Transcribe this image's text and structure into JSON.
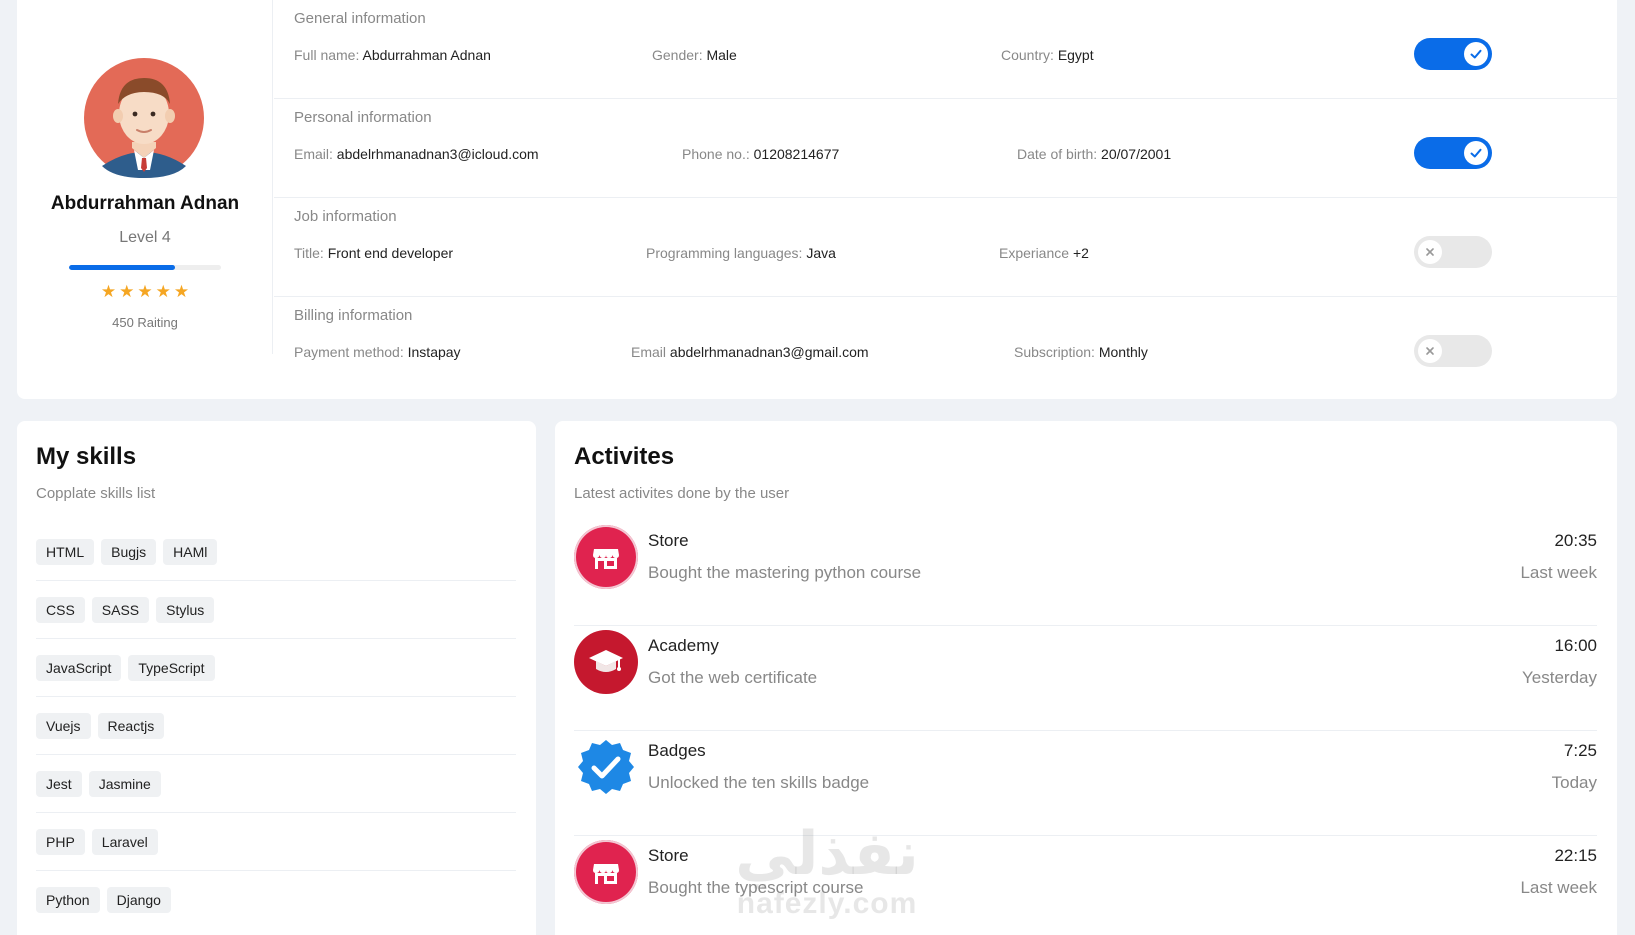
{
  "profile": {
    "name": "Abdurrahman Adnan",
    "level": "Level 4",
    "level_progress": 0.7,
    "stars": 5,
    "rating": "450 Raiting"
  },
  "sections": [
    {
      "title": "General information",
      "fields": [
        {
          "label": "Full name: ",
          "value": "Abdurrahman Adnan"
        },
        {
          "label": "Gender: ",
          "value": "Male"
        },
        {
          "label": "Country: ",
          "value": "Egypt"
        }
      ],
      "enabled": true
    },
    {
      "title": "Personal information",
      "fields": [
        {
          "label": "Email: ",
          "value": "abdelrhmanadnan3@icloud.com"
        },
        {
          "label": "Phone no.: ",
          "value": "01208214677"
        },
        {
          "label": "Date of birth: ",
          "value": "20/07/2001"
        }
      ],
      "enabled": true
    },
    {
      "title": "Job information",
      "fields": [
        {
          "label": "Title: ",
          "value": "Front end developer"
        },
        {
          "label": "Programming languages: ",
          "value": "Java"
        },
        {
          "label": "Experiance ",
          "value": "+2"
        }
      ],
      "enabled": false
    },
    {
      "title": "Billing information",
      "fields": [
        {
          "label": "Payment method: ",
          "value": "Instapay"
        },
        {
          "label": "Email ",
          "value": "abdelrhmanadnan3@gmail.com"
        },
        {
          "label": "Subscription: ",
          "value": "Monthly"
        }
      ],
      "enabled": false
    }
  ],
  "skills": {
    "title": "My skills",
    "subtitle": "Copplate skills list",
    "rows": [
      [
        "HTML",
        "Bugjs",
        "HAMl"
      ],
      [
        "CSS",
        "SASS",
        "Stylus"
      ],
      [
        "JavaScript",
        "TypeScript"
      ],
      [
        "Vuejs",
        "Reactjs"
      ],
      [
        "Jest",
        "Jasmine"
      ],
      [
        "PHP",
        "Laravel"
      ],
      [
        "Python",
        "Django"
      ]
    ]
  },
  "activities": {
    "title": "Activites",
    "subtitle": "Latest activites done by the user",
    "items": [
      {
        "icon": "store-icon",
        "title": "Store",
        "desc": "Bought the mastering python course",
        "time": "20:35",
        "when": "Last week"
      },
      {
        "icon": "graduation-cap-icon",
        "title": "Academy",
        "desc": "Got the web certificate",
        "time": "16:00",
        "when": "Yesterday"
      },
      {
        "icon": "verified-badge-icon",
        "title": "Badges",
        "desc": "Unlocked the ten skills badge",
        "time": "7:25",
        "when": "Today"
      },
      {
        "icon": "store-icon",
        "title": "Store",
        "desc": "Bought the typescript course",
        "time": "22:15",
        "when": "Last week"
      }
    ]
  },
  "watermark": {
    "arabic": "نفذلي",
    "latin": "nafezly.com"
  },
  "colors": {
    "accent": "#0a6ce8",
    "star": "#f5a623",
    "store": "#e0234f",
    "academy": "#c5182e",
    "badge": "#1e88e5"
  }
}
